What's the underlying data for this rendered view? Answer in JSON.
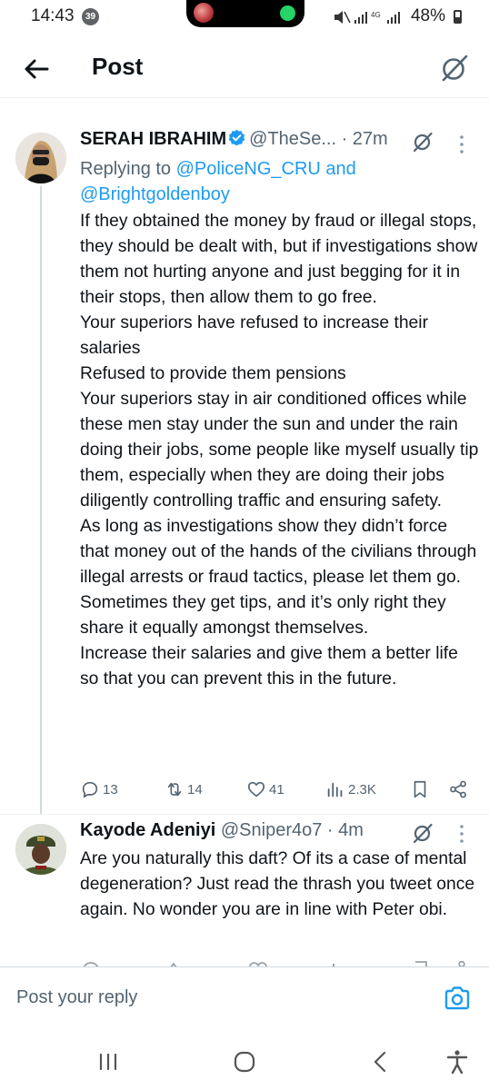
{
  "status_bar": {
    "time": "14:43",
    "notification_count": "39",
    "network": "4G",
    "battery": "48%"
  },
  "header": {
    "title": "Post"
  },
  "tweet": {
    "author_name": "SERAH IBRAHIM",
    "handle": "@TheSe...",
    "time": "· 27m",
    "reply_prefix": "Replying to",
    "reply_to_1": "@PoliceNG_CRU",
    "reply_joiner": "and",
    "reply_to_2": "@Brightgoldenboy",
    "body": "If they obtained the money by fraud or illegal stops, they should be dealt with, but if investigations show them not hurting anyone and just begging for it in their stops, then allow them to go free.\nYour superiors have refused to increase their salaries\nRefused to provide them pensions\nYour superiors stay in air conditioned offices while these men stay under the sun and under the rain doing their jobs, some people like myself usually tip them, especially when they are doing their jobs diligently controlling traffic and ensuring safety.\nAs long as investigations show they didn’t force that money out of the hands of the civilians through illegal arrests or fraud tactics, please let them go. Sometimes they get tips, and it’s only right they share it equally amongst themselves.\nIncrease their salaries and give them a better life so that you can prevent this in the future.",
    "replies": "13",
    "reposts": "14",
    "likes": "41",
    "views": "2.3K"
  },
  "reply": {
    "author_name": "Kayode Adeniyi",
    "handle": "@Sniper4o7",
    "time": "· 4m",
    "body": "Are you naturally this daft? Of its a case of mental degeneration? Just read the thrash you tweet once again. No wonder you are in line with Peter obi."
  },
  "composer": {
    "placeholder": "Post your reply"
  },
  "colors": {
    "accent": "#1d9bf0",
    "secondary_text": "#536471"
  }
}
